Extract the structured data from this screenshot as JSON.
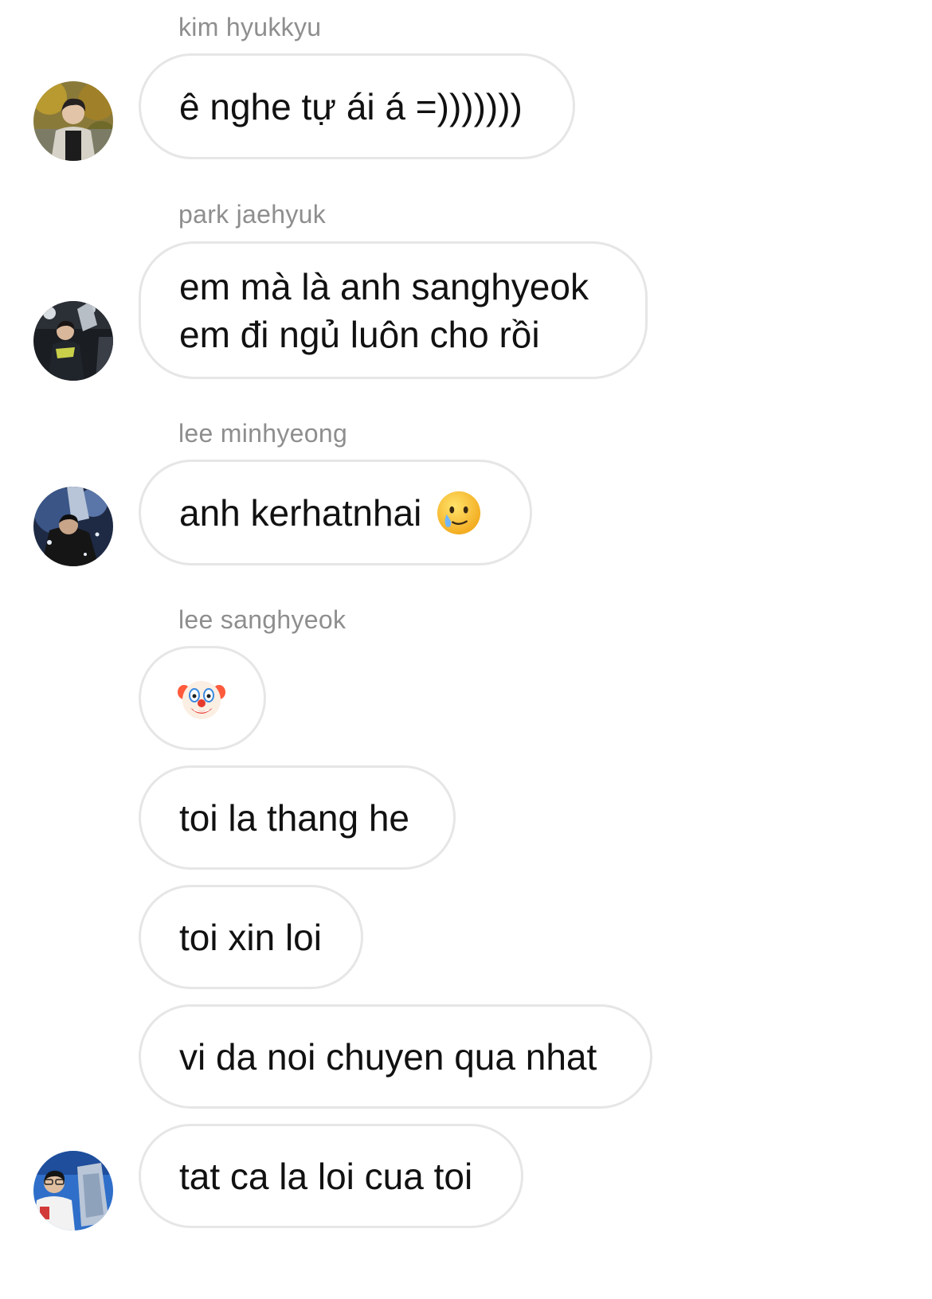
{
  "messages": [
    {
      "sender": "kim hyukkyu",
      "bubbles": [
        "ê nghe tự ái á =)))))))"
      ]
    },
    {
      "sender": "park jaehyuk",
      "bubbles": [
        [
          "em mà là anh sanghyeok",
          "em đi ngủ luôn cho rồi"
        ]
      ]
    },
    {
      "sender": "lee minhyeong",
      "bubbles": [
        "anh kerhatnhai"
      ],
      "emoji": "sad-but-relieved-face-icon"
    },
    {
      "sender": "lee sanghyeok",
      "emoji_bubble": "clown-face-icon",
      "bubbles": [
        "toi la thang he",
        "toi xin loi",
        "vi da noi chuyen qua nhat",
        "tat ca la loi cua toi"
      ]
    }
  ],
  "colors": {
    "bubble_border": "#e6e6e6",
    "sender_text": "#8e8e8e",
    "message_text": "#111111",
    "background": "#ffffff"
  }
}
